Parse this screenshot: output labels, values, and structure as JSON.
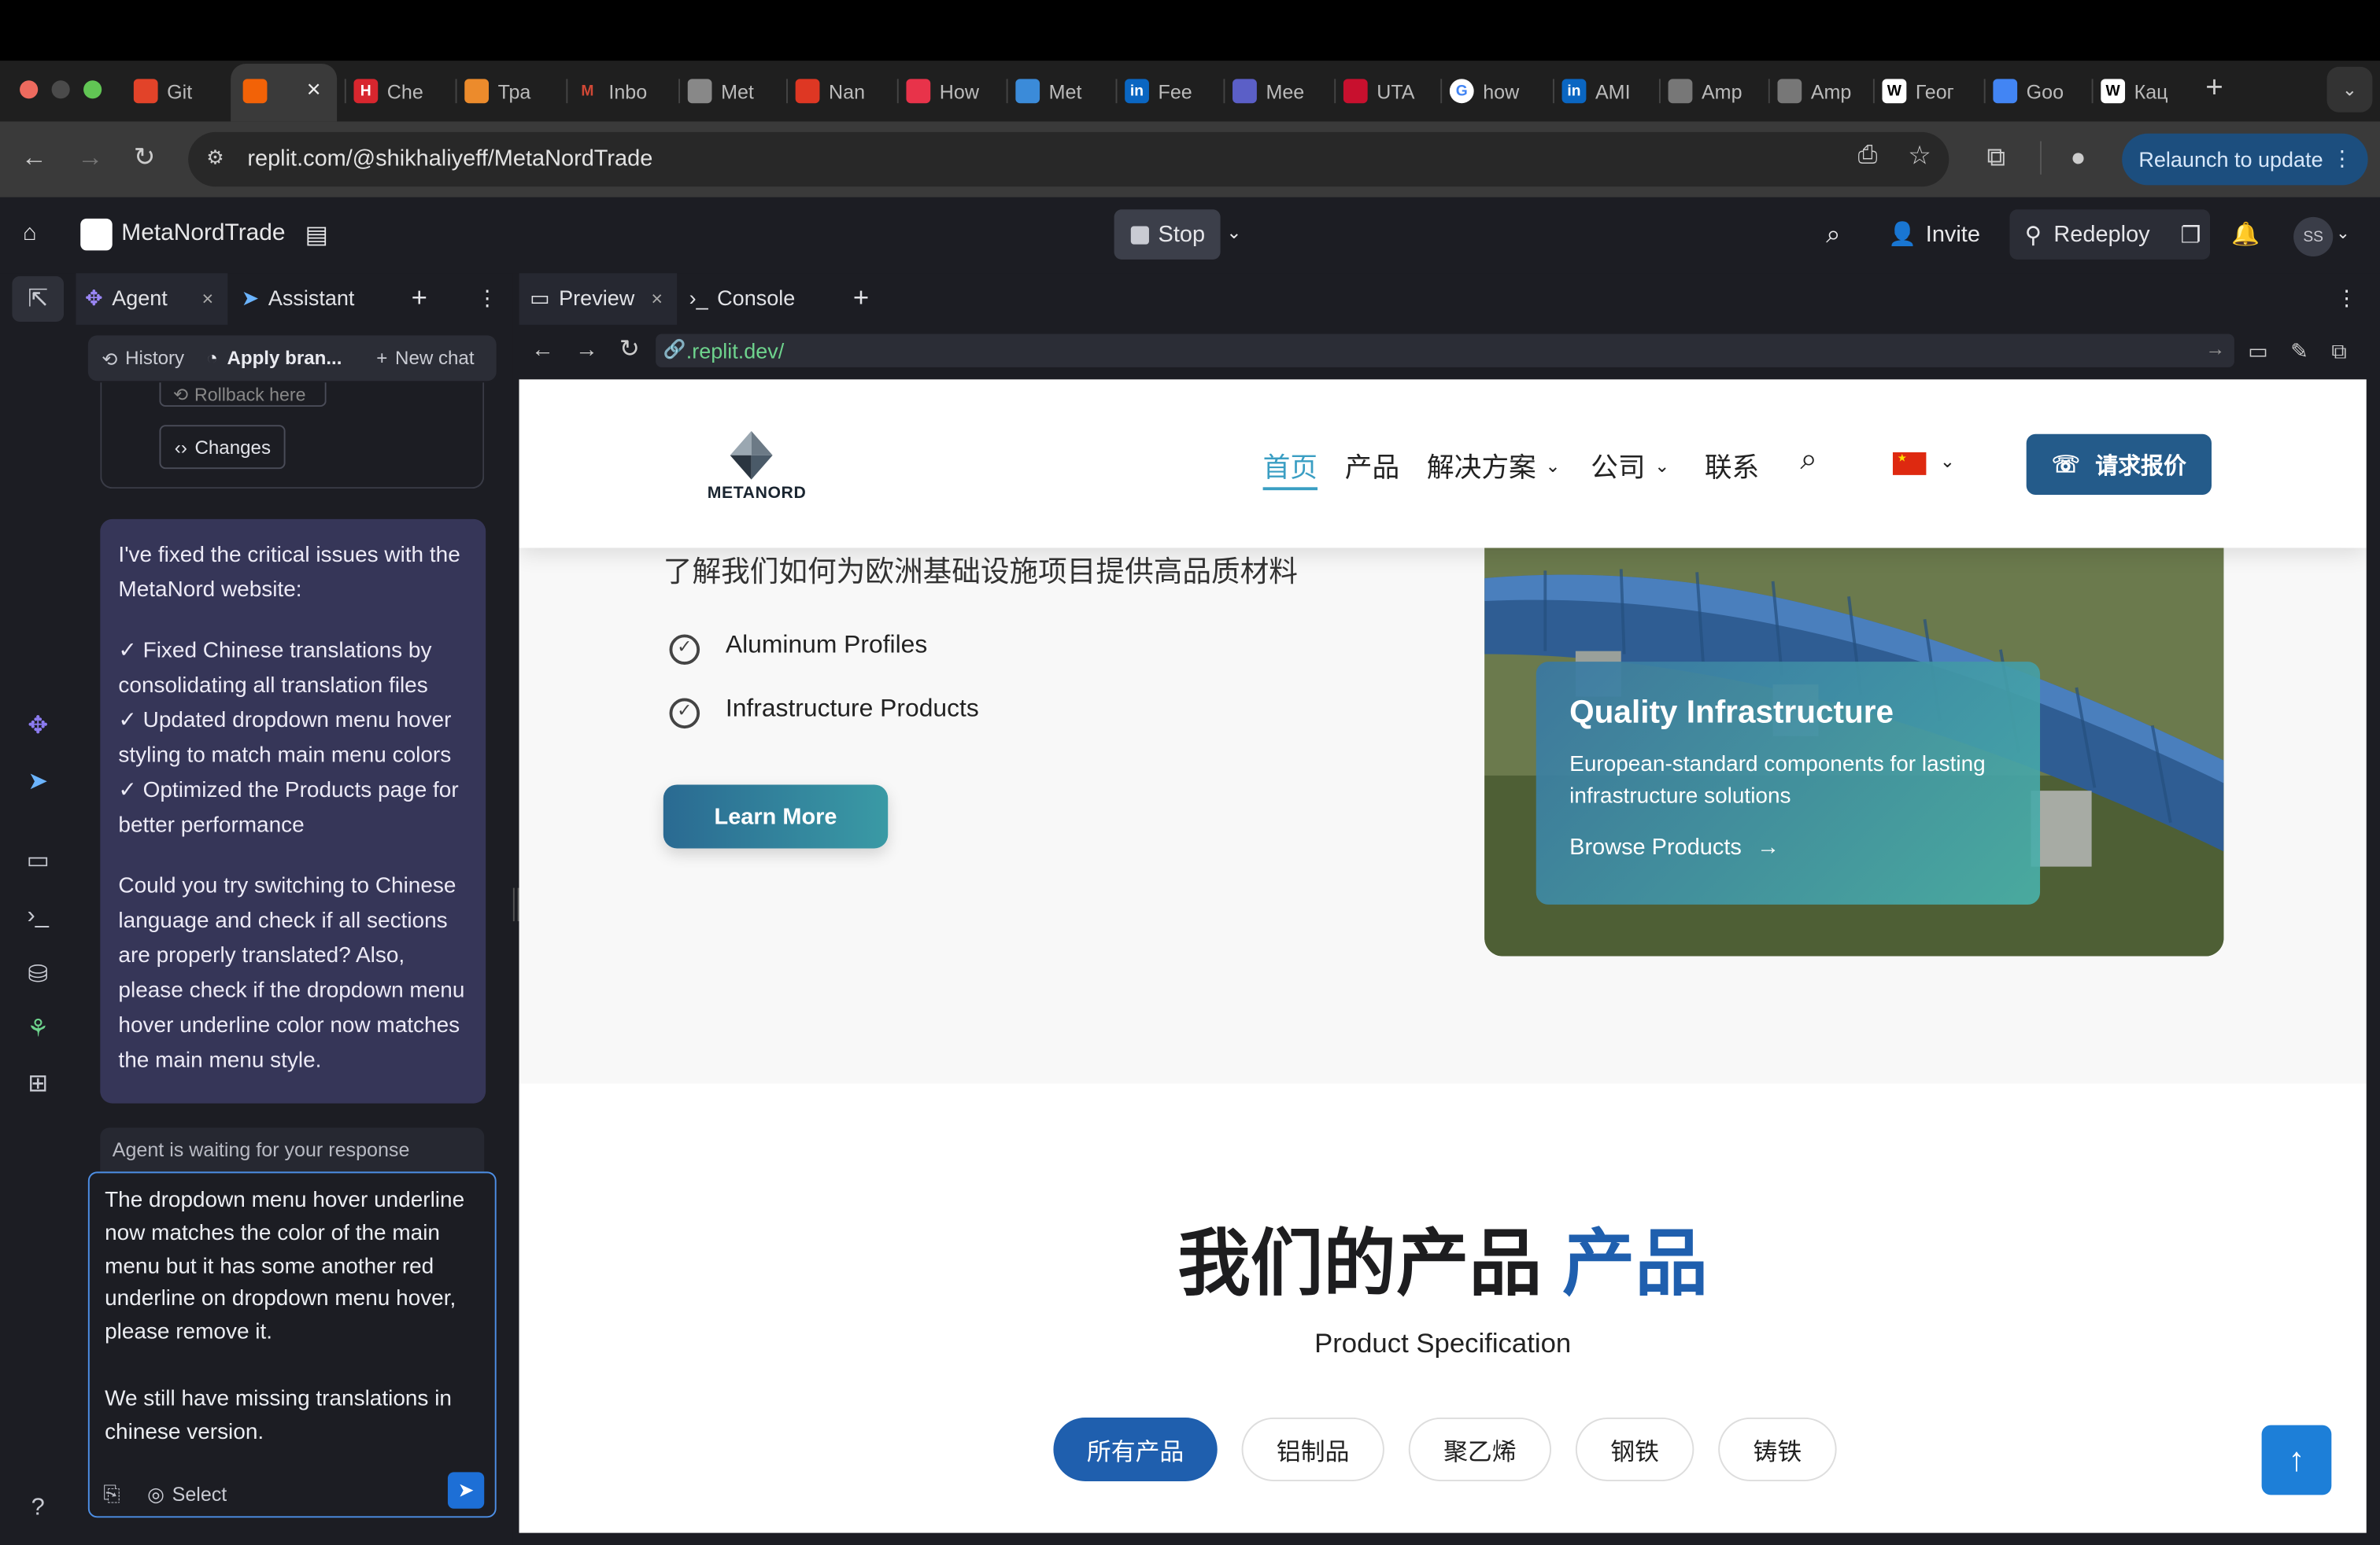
{
  "browser": {
    "tabs": [
      {
        "label": "Git",
        "icon": "gitlab-icon",
        "color": "#e24329"
      },
      {
        "label": "",
        "icon": "replit-icon",
        "color": "#f26207"
      },
      {
        "label": "Che",
        "icon": "h-icon",
        "color": "#d8262e"
      },
      {
        "label": "Тра",
        "icon": "translate-icon",
        "color": "#ec8b2c"
      },
      {
        "label": "Inbo",
        "icon": "gmail-icon",
        "color": "#d14836"
      },
      {
        "label": "Met",
        "icon": "globe-icon",
        "color": "#888888"
      },
      {
        "label": "Nan",
        "icon": "namecheap-icon",
        "color": "#de3723"
      },
      {
        "label": "How",
        "icon": "help-icon",
        "color": "#e8334a"
      },
      {
        "label": "Met",
        "icon": "meta-icon",
        "color": "#3b8bd9"
      },
      {
        "label": "Fee",
        "icon": "linkedin-icon",
        "color": "#0a66c2"
      },
      {
        "label": "Mee",
        "icon": "teams-icon",
        "color": "#5b5fc7"
      },
      {
        "label": "UTA",
        "icon": "uta-icon",
        "color": "#c8102e"
      },
      {
        "label": "how",
        "icon": "google-icon",
        "color": "#4285f4"
      },
      {
        "label": "AMI",
        "icon": "linkedin-icon",
        "color": "#0a66c2"
      },
      {
        "label": "Amp",
        "icon": "amp-icon",
        "color": "#777777"
      },
      {
        "label": "Amp",
        "icon": "amp-icon",
        "color": "#777777"
      },
      {
        "label": "Геог",
        "icon": "wikipedia-icon",
        "color": "#ffffff"
      },
      {
        "label": "Goo",
        "icon": "google-translate-icon",
        "color": "#4285f4"
      },
      {
        "label": "Кац",
        "icon": "wikipedia-icon",
        "color": "#ffffff"
      }
    ],
    "url": "replit.com/@shikhaliyeff/MetaNordTrade",
    "relaunch": "Relaunch to update"
  },
  "replit": {
    "project_name": "MetaNordTrade",
    "stop_label": "Stop",
    "invite_label": "Invite",
    "redeploy_label": "Redeploy",
    "avatar_initials": "SS"
  },
  "agent_panel": {
    "tabs": [
      "Agent",
      "Assistant"
    ],
    "history_label": "History",
    "apply_label": "Apply bran...",
    "new_chat_label": "New chat",
    "rollback_label": "Rollback here",
    "changes_label": "Changes",
    "message_paragraphs": [
      "I've fixed the critical issues with the MetaNord website:",
      "✓ Fixed Chinese translations by consolidating all translation files\n✓ Updated dropdown menu hover styling to match main menu colors\n✓ Optimized the Products page for better performance",
      "Could you try switching to Chinese language and check if all sections are properly translated? Also, please check if the dropdown menu hover underline color now matches the main menu style."
    ],
    "status": "Agent is waiting for your response",
    "input_text": "The dropdown menu hover underline now matches the color of the main menu but it has some another red underline on dropdown menu hover, please remove it.\n\nWe still have missing translations in chinese version.",
    "select_label": "Select"
  },
  "preview_panel": {
    "tabs": [
      "Preview",
      "Console"
    ],
    "url": ".replit.dev/"
  },
  "website": {
    "logo_text": "METANORD",
    "nav": [
      "首页",
      "产品",
      "解决方案",
      "公司",
      "联系"
    ],
    "quote_button": "请求报价",
    "hero_subtitle": "了解我们如何为欧洲基础设施项目提供高品质材料",
    "features": [
      "Aluminum Profiles",
      "Infrastructure Products"
    ],
    "learn_more": "Learn More",
    "card_title": "Quality Infrastructure",
    "card_text": "European-standard components for lasting infrastructure solutions",
    "card_link": "Browse Products",
    "products_heading_dark": "我们的产品",
    "products_heading_blue": "产品",
    "products_subtitle": "Product Specification",
    "filters": [
      "所有产品",
      "铝制品",
      "聚乙烯",
      "钢铁",
      "铸铁"
    ]
  },
  "colors": {
    "accent": "#1d7fd8",
    "agent_bubble": "#363658",
    "brand_blue": "#245b8a"
  }
}
